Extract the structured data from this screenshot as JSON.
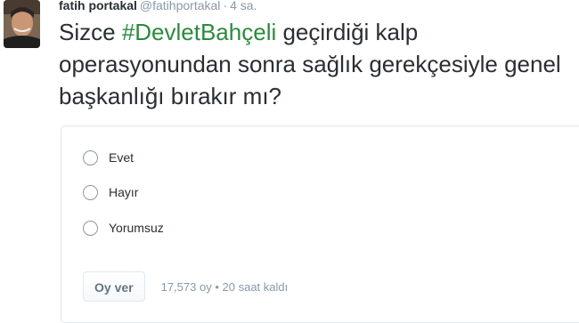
{
  "tweet": {
    "author_name": "fatih portakal",
    "handle": "@fatihportakal",
    "separator": "·",
    "timestamp": "4 sa.",
    "text_before": "Sizce ",
    "hashtag": "#DevletBahçeli",
    "text_after": " geçirdiği kalp operasyonundan sonra sağlık gerekçesiyle genel başkanlığı bırakır mı?"
  },
  "poll": {
    "choices": [
      "Evet",
      "Hayır",
      "Yorumsuz"
    ],
    "vote_button_label": "Oy ver",
    "vote_count": "17,573 oy",
    "dot": "•",
    "time_left": "20 saat kaldı"
  },
  "colors": {
    "hashtag": "#2b8a3e",
    "muted": "#8899a6",
    "text": "#292f33"
  }
}
